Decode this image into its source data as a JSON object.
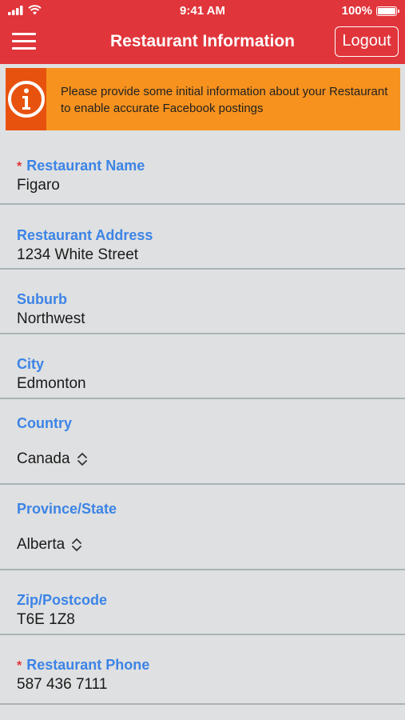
{
  "status_bar": {
    "time": "9:41 AM",
    "battery": "100%"
  },
  "nav": {
    "title": "Restaurant Information",
    "logout_label": "Logout"
  },
  "banner": {
    "text": "Please provide some initial information about your Restaurant to enable accurate Facebook postings",
    "icon": "info-icon"
  },
  "form": {
    "restaurant_name": {
      "required": "*",
      "label": "Restaurant Name",
      "value": "Figaro"
    },
    "restaurant_address": {
      "label": "Restaurant Address",
      "value": "1234 White Street"
    },
    "suburb": {
      "label": "Suburb",
      "value": "Northwest"
    },
    "city": {
      "label": "City",
      "value": "Edmonton"
    },
    "country": {
      "label": "Country",
      "value": "Canada"
    },
    "province": {
      "label": "Province/State",
      "value": "Alberta"
    },
    "zip": {
      "label": "Zip/Postcode",
      "value": "T6E 1Z8"
    },
    "phone": {
      "required": "*",
      "label": "Restaurant Phone",
      "value": "587 436 7111"
    }
  },
  "colors": {
    "header": "#e0353b",
    "banner": "#f7921e",
    "banner_icon_bg": "#e8520f",
    "label": "#3c84e6",
    "background": "#dfe0e1"
  }
}
